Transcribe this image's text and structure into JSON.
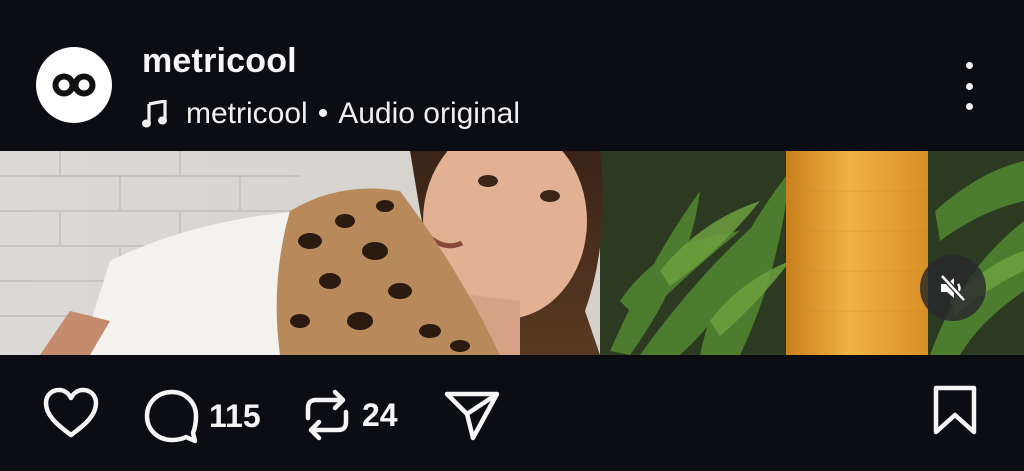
{
  "header": {
    "username": "metricool",
    "audio_artist": "metricool",
    "audio_separator": "•",
    "audio_label": "Audio original"
  },
  "icons": {
    "avatar": "infinity-logo-icon",
    "music": "music-note-icon",
    "more": "more-vertical-icon",
    "mute": "volume-muted-icon",
    "like": "heart-icon",
    "comment": "comment-icon",
    "repost": "repost-icon",
    "share": "send-icon",
    "save": "bookmark-icon"
  },
  "actions": {
    "comments_count": "115",
    "reposts_count": "24"
  },
  "colors": {
    "background": "#0c0d12",
    "text": "#f5f5f5",
    "lamp": "#e8a638",
    "plant": "#3f6a2a"
  }
}
